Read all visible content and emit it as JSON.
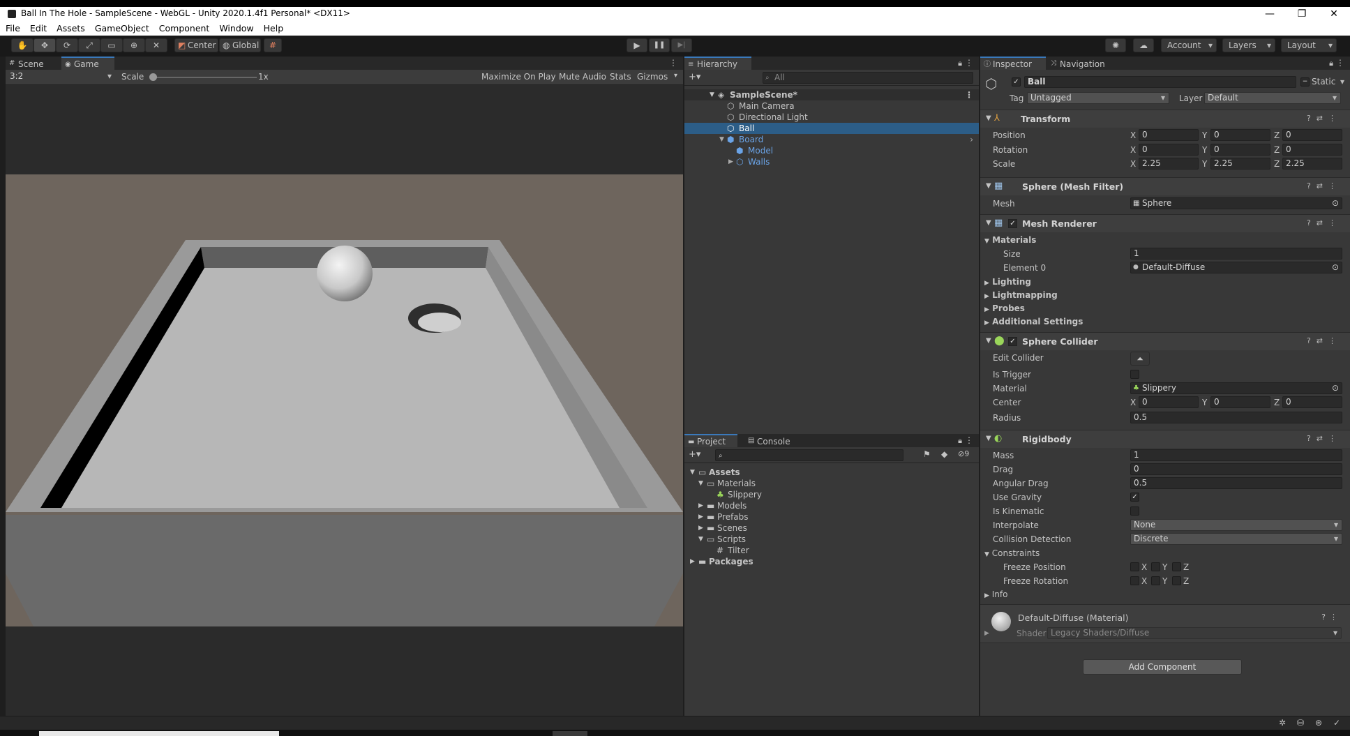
{
  "window": {
    "title": "Ball In The Hole - SampleScene - WebGL - Unity 2020.1.4f1 Personal* <DX11>",
    "minimize": "—",
    "maximize": "❐",
    "close": "✕"
  },
  "menu": [
    "File",
    "Edit",
    "Assets",
    "GameObject",
    "Component",
    "Window",
    "Help"
  ],
  "toolbar": {
    "pivot": "Center",
    "space": "Global",
    "play": "▶",
    "pause": "❚❚",
    "step": "▶|",
    "account": "Account",
    "layers": "Layers",
    "layout": "Layout"
  },
  "game_view": {
    "tabs": [
      "Scene",
      "Game"
    ],
    "aspect": "3:2",
    "scale_label": "Scale",
    "scale_value": "1x",
    "options": [
      "Maximize On Play",
      "Mute Audio",
      "Stats",
      "Gizmos"
    ]
  },
  "hierarchy": {
    "tab": "Hierarchy",
    "search_placeholder": "All",
    "scene": "SampleScene*",
    "items": [
      "Main Camera",
      "Directional Light",
      "Ball",
      "Board",
      "Model",
      "Walls"
    ]
  },
  "project": {
    "tabs": [
      "Project",
      "Console"
    ],
    "hidden_count": "9",
    "items": [
      "Assets",
      "Materials",
      "Slippery",
      "Models",
      "Prefabs",
      "Scenes",
      "Scripts",
      "Tilter",
      "Packages"
    ]
  },
  "inspector": {
    "tabs": [
      "Inspector",
      "Navigation"
    ],
    "object_name": "Ball",
    "static_label": "Static",
    "tag_label": "Tag",
    "tag_value": "Untagged",
    "layer_label": "Layer",
    "layer_value": "Default",
    "transform": {
      "title": "Transform",
      "position_label": "Position",
      "position": [
        "0",
        "0",
        "0"
      ],
      "rotation_label": "Rotation",
      "rotation": [
        "0",
        "0",
        "0"
      ],
      "scale_label": "Scale",
      "scale": [
        "2.25",
        "2.25",
        "2.25"
      ]
    },
    "mesh_filter": {
      "title": "Sphere (Mesh Filter)",
      "mesh_label": "Mesh",
      "mesh_value": "Sphere"
    },
    "mesh_renderer": {
      "title": "Mesh Renderer",
      "materials_label": "Materials",
      "size_label": "Size",
      "size_value": "1",
      "element_label": "Element 0",
      "element_value": "Default-Diffuse",
      "sections": [
        "Lighting",
        "Lightmapping",
        "Probes",
        "Additional Settings"
      ]
    },
    "sphere_collider": {
      "title": "Sphere Collider",
      "edit_label": "Edit Collider",
      "trigger_label": "Is Trigger",
      "material_label": "Material",
      "material_value": "Slippery",
      "center_label": "Center",
      "center": [
        "0",
        "0",
        "0"
      ],
      "radius_label": "Radius",
      "radius_value": "0.5"
    },
    "rigidbody": {
      "title": "Rigidbody",
      "mass_label": "Mass",
      "mass_value": "1",
      "drag_label": "Drag",
      "drag_value": "0",
      "angular_label": "Angular Drag",
      "angular_value": "0.5",
      "gravity_label": "Use Gravity",
      "kinematic_label": "Is Kinematic",
      "interpolate_label": "Interpolate",
      "interpolate_value": "None",
      "collision_label": "Collision Detection",
      "collision_value": "Discrete",
      "constraints_label": "Constraints",
      "freeze_pos_label": "Freeze Position",
      "freeze_rot_label": "Freeze Rotation",
      "info_label": "Info"
    },
    "axis_labels": [
      "X",
      "Y",
      "Z"
    ],
    "material_preview": {
      "title": "Default-Diffuse (Material)",
      "shader_label": "Shader",
      "shader_value": "Legacy Shaders/Diffuse"
    },
    "add_component": "Add Component"
  },
  "colors": {
    "accent": "#3a79bb",
    "selection": "#2c5d87",
    "panel": "#383838",
    "background": "#1e1e1e"
  }
}
